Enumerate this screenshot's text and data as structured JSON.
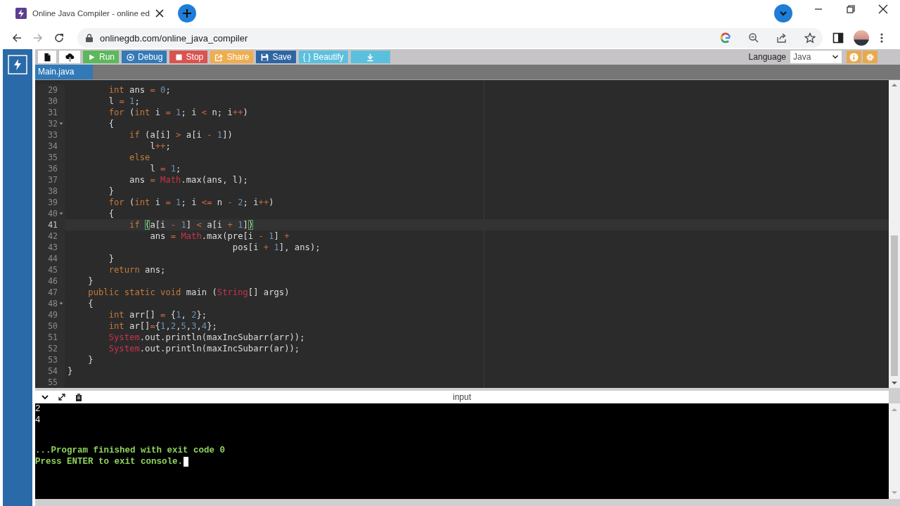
{
  "browser": {
    "tab_title": "Online Java Compiler - online ed",
    "url": "onlinegdb.com/online_java_compiler"
  },
  "toolbar": {
    "buttons": [
      {
        "kind": "new-file"
      },
      {
        "kind": "upload"
      },
      {
        "kind": "run",
        "label": "Run"
      },
      {
        "kind": "debug",
        "label": "Debug"
      },
      {
        "kind": "stop",
        "label": "Stop"
      },
      {
        "kind": "share",
        "label": "Share"
      },
      {
        "kind": "save",
        "label": "Save"
      },
      {
        "kind": "beautify",
        "label": "{ } Beautify"
      },
      {
        "kind": "download"
      }
    ],
    "language_label": "Language",
    "language": "Java"
  },
  "file_tabs": [
    {
      "label": "Main.java",
      "selected": true
    }
  ],
  "editor": {
    "lines": [
      {
        "number": "29",
        "current": false,
        "foldable": false,
        "tokens": [
          {
            "kind": "keyword",
            "text": "        int"
          },
          {
            "kind": "plain",
            "text": " ans "
          },
          {
            "kind": "operator",
            "text": "="
          },
          {
            "kind": "number",
            "text": " 0"
          },
          {
            "kind": "plain",
            "text": ";"
          }
        ]
      },
      {
        "number": "30",
        "current": false,
        "foldable": false,
        "tokens": [
          {
            "kind": "plain",
            "text": "        l "
          },
          {
            "kind": "operator",
            "text": "="
          },
          {
            "kind": "number",
            "text": " 1"
          },
          {
            "kind": "plain",
            "text": ";"
          }
        ]
      },
      {
        "number": "31",
        "current": false,
        "foldable": false,
        "tokens": [
          {
            "kind": "keyword",
            "text": "        for"
          },
          {
            "kind": "plain",
            "text": " ("
          },
          {
            "kind": "keyword",
            "text": "int"
          },
          {
            "kind": "plain",
            "text": " i "
          },
          {
            "kind": "operator",
            "text": "="
          },
          {
            "kind": "number",
            "text": " 1"
          },
          {
            "kind": "plain",
            "text": "; i "
          },
          {
            "kind": "operator",
            "text": "<"
          },
          {
            "kind": "plain",
            "text": " n; i"
          },
          {
            "kind": "operator",
            "text": "++"
          },
          {
            "kind": "plain",
            "text": ")"
          }
        ]
      },
      {
        "number": "32",
        "current": false,
        "foldable": true,
        "tokens": [
          {
            "kind": "plain",
            "text": "        {"
          }
        ]
      },
      {
        "number": "33",
        "current": false,
        "foldable": false,
        "tokens": [
          {
            "kind": "keyword",
            "text": "            if"
          },
          {
            "kind": "plain",
            "text": " (a[i] "
          },
          {
            "kind": "operator",
            "text": ">"
          },
          {
            "kind": "plain",
            "text": " a[i "
          },
          {
            "kind": "operator",
            "text": "-"
          },
          {
            "kind": "number",
            "text": " 1"
          },
          {
            "kind": "plain",
            "text": "])"
          }
        ]
      },
      {
        "number": "34",
        "current": false,
        "foldable": false,
        "tokens": [
          {
            "kind": "plain",
            "text": "                l"
          },
          {
            "kind": "operator",
            "text": "++"
          },
          {
            "kind": "plain",
            "text": ";"
          }
        ]
      },
      {
        "number": "35",
        "current": false,
        "foldable": false,
        "tokens": [
          {
            "kind": "keyword",
            "text": "            else"
          }
        ]
      },
      {
        "number": "36",
        "current": false,
        "foldable": false,
        "tokens": [
          {
            "kind": "plain",
            "text": "                l "
          },
          {
            "kind": "operator",
            "text": "="
          },
          {
            "kind": "number",
            "text": " 1"
          },
          {
            "kind": "plain",
            "text": ";"
          }
        ]
      },
      {
        "number": "37",
        "current": false,
        "foldable": false,
        "tokens": [
          {
            "kind": "plain",
            "text": "            ans "
          },
          {
            "kind": "operator",
            "text": "="
          },
          {
            "kind": "class",
            "text": " Math"
          },
          {
            "kind": "plain",
            "text": ".max(ans, l);"
          }
        ]
      },
      {
        "number": "38",
        "current": false,
        "foldable": false,
        "tokens": [
          {
            "kind": "plain",
            "text": "        }"
          }
        ]
      },
      {
        "number": "39",
        "current": false,
        "foldable": false,
        "tokens": [
          {
            "kind": "keyword",
            "text": "        for"
          },
          {
            "kind": "plain",
            "text": " ("
          },
          {
            "kind": "keyword",
            "text": "int"
          },
          {
            "kind": "plain",
            "text": " i "
          },
          {
            "kind": "operator",
            "text": "="
          },
          {
            "kind": "number",
            "text": " 1"
          },
          {
            "kind": "plain",
            "text": "; i "
          },
          {
            "kind": "operator",
            "text": "<="
          },
          {
            "kind": "plain",
            "text": " n "
          },
          {
            "kind": "operator",
            "text": "-"
          },
          {
            "kind": "number",
            "text": " 2"
          },
          {
            "kind": "plain",
            "text": "; i"
          },
          {
            "kind": "operator",
            "text": "++"
          },
          {
            "kind": "plain",
            "text": ")"
          }
        ]
      },
      {
        "number": "40",
        "current": false,
        "foldable": true,
        "tokens": [
          {
            "kind": "plain",
            "text": "        {"
          }
        ]
      },
      {
        "number": "41",
        "current": true,
        "foldable": false,
        "tokens": [
          {
            "kind": "keyword",
            "text": "            if "
          },
          {
            "kind": "match",
            "text": "("
          },
          {
            "kind": "plain",
            "text": "a[i "
          },
          {
            "kind": "operator",
            "text": "-"
          },
          {
            "kind": "number",
            "text": " 1"
          },
          {
            "kind": "plain",
            "text": "] "
          },
          {
            "kind": "operator",
            "text": "<"
          },
          {
            "kind": "plain",
            "text": " a[i "
          },
          {
            "kind": "operator",
            "text": "+"
          },
          {
            "kind": "number",
            "text": " 1"
          },
          {
            "kind": "plain",
            "text": "]"
          },
          {
            "kind": "match",
            "text": ")"
          }
        ]
      },
      {
        "number": "42",
        "current": false,
        "foldable": false,
        "tokens": [
          {
            "kind": "plain",
            "text": "                ans "
          },
          {
            "kind": "operator",
            "text": "="
          },
          {
            "kind": "class",
            "text": " Math"
          },
          {
            "kind": "plain",
            "text": ".max(pre[i "
          },
          {
            "kind": "operator",
            "text": "-"
          },
          {
            "kind": "number",
            "text": " 1"
          },
          {
            "kind": "plain",
            "text": "] "
          },
          {
            "kind": "operator",
            "text": "+"
          }
        ]
      },
      {
        "number": "43",
        "current": false,
        "foldable": false,
        "tokens": [
          {
            "kind": "plain",
            "text": "                                pos[i "
          },
          {
            "kind": "operator",
            "text": "+"
          },
          {
            "kind": "number",
            "text": " 1"
          },
          {
            "kind": "plain",
            "text": "], ans);"
          }
        ]
      },
      {
        "number": "44",
        "current": false,
        "foldable": false,
        "tokens": [
          {
            "kind": "plain",
            "text": "        }"
          }
        ]
      },
      {
        "number": "45",
        "current": false,
        "foldable": false,
        "tokens": [
          {
            "kind": "keyword",
            "text": "        return"
          },
          {
            "kind": "plain",
            "text": " ans;"
          }
        ]
      },
      {
        "number": "46",
        "current": false,
        "foldable": false,
        "tokens": [
          {
            "kind": "plain",
            "text": "    }"
          }
        ]
      },
      {
        "number": "47",
        "current": false,
        "foldable": false,
        "tokens": [
          {
            "kind": "keyword",
            "text": "    public static void"
          },
          {
            "kind": "plain",
            "text": " main ("
          },
          {
            "kind": "class",
            "text": "String"
          },
          {
            "kind": "plain",
            "text": "[] args)"
          }
        ]
      },
      {
        "number": "48",
        "current": false,
        "foldable": true,
        "tokens": [
          {
            "kind": "plain",
            "text": "    {"
          }
        ]
      },
      {
        "number": "49",
        "current": false,
        "foldable": false,
        "tokens": [
          {
            "kind": "keyword",
            "text": "        int"
          },
          {
            "kind": "plain",
            "text": " arr[] "
          },
          {
            "kind": "operator",
            "text": "="
          },
          {
            "kind": "plain",
            "text": " {"
          },
          {
            "kind": "number",
            "text": "1"
          },
          {
            "kind": "plain",
            "text": ", "
          },
          {
            "kind": "number",
            "text": "2"
          },
          {
            "kind": "plain",
            "text": "};"
          }
        ]
      },
      {
        "number": "50",
        "current": false,
        "foldable": false,
        "tokens": [
          {
            "kind": "keyword",
            "text": "        int"
          },
          {
            "kind": "plain",
            "text": " ar[]"
          },
          {
            "kind": "operator",
            "text": "="
          },
          {
            "kind": "plain",
            "text": "{"
          },
          {
            "kind": "number",
            "text": "1"
          },
          {
            "kind": "plain",
            "text": ","
          },
          {
            "kind": "number",
            "text": "2"
          },
          {
            "kind": "plain",
            "text": ","
          },
          {
            "kind": "number",
            "text": "5"
          },
          {
            "kind": "plain",
            "text": ","
          },
          {
            "kind": "number",
            "text": "3"
          },
          {
            "kind": "plain",
            "text": ","
          },
          {
            "kind": "number",
            "text": "4"
          },
          {
            "kind": "plain",
            "text": "};"
          }
        ]
      },
      {
        "number": "51",
        "current": false,
        "foldable": false,
        "tokens": [
          {
            "kind": "class",
            "text": "        System"
          },
          {
            "kind": "plain",
            "text": ".out.println(maxIncSubarr(arr));"
          }
        ]
      },
      {
        "number": "52",
        "current": false,
        "foldable": false,
        "tokens": [
          {
            "kind": "class",
            "text": "        System"
          },
          {
            "kind": "plain",
            "text": ".out.println(maxIncSubarr(ar));"
          }
        ]
      },
      {
        "number": "53",
        "current": false,
        "foldable": false,
        "tokens": [
          {
            "kind": "plain",
            "text": "    }"
          }
        ]
      },
      {
        "number": "54",
        "current": false,
        "foldable": false,
        "tokens": [
          {
            "kind": "plain",
            "text": "}"
          }
        ]
      },
      {
        "number": "55",
        "current": false,
        "foldable": false
      }
    ]
  },
  "console": {
    "label": "input",
    "cursor": true,
    "lines": [
      {
        "kind": "output",
        "text": "2"
      },
      {
        "kind": "output",
        "text": "4"
      },
      {
        "kind": "status",
        "text": "...Program finished with exit code 0"
      },
      {
        "kind": "status",
        "text": "Press ENTER to exit console."
      }
    ]
  }
}
